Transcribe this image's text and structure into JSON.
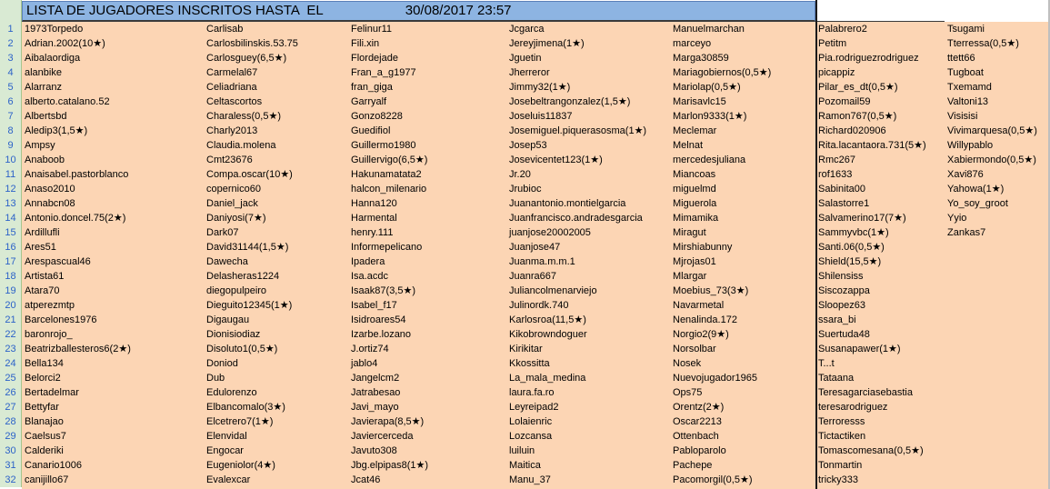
{
  "header": {
    "title": "LISTA DE JUGADORES INSCRITOS HASTA  EL",
    "datetime": "30/08/2017 23:57"
  },
  "rows": [
    {
      "n": "1",
      "c": [
        "1973Torpedo",
        "Carlisab",
        "Felinur11",
        "Jcgarca",
        "Manuelmarchan",
        "Palabrero2",
        "Tsugami"
      ]
    },
    {
      "n": "2",
      "c": [
        "Adrian.2002(10★)",
        "Carlosbilinskis.53.75",
        "Fili.xin",
        "Jereyjimena(1★)",
        "marceyo",
        "Petitm",
        "Tterressa(0,5★)"
      ]
    },
    {
      "n": "3",
      "c": [
        "Aibalaordiga",
        "Carlosguey(6,5★)",
        "Flordejade",
        "Jguetin",
        "Marga30859",
        "Pia.rodriguezrodriguez",
        "ttett66"
      ]
    },
    {
      "n": "4",
      "c": [
        "alanbike",
        "Carmelal67",
        "Fran_a_g1977",
        "Jherreror",
        "Mariagobiernos(0,5★)",
        "picappiz",
        "Tugboat"
      ]
    },
    {
      "n": "5",
      "c": [
        "Alarranz",
        "Celiadriana",
        "fran_giga",
        "Jimmy32(1★)",
        "Mariolap(0,5★)",
        "Pilar_es_dt(0,5★)",
        "Txemamd"
      ]
    },
    {
      "n": "6",
      "c": [
        "alberto.catalano.52",
        "Celtascortos",
        "Garryalf",
        "Josebeltrangonzalez(1,5★)",
        "Marisavlc15",
        "Pozomail59",
        "Valtoni13"
      ]
    },
    {
      "n": "7",
      "c": [
        "Albertsbd",
        "Charaless(0,5★)",
        "Gonzo8228",
        "Joseluis11837",
        "Marlon9333(1★)",
        "Ramon767(0,5★)",
        "Visisisi"
      ]
    },
    {
      "n": "8",
      "c": [
        "Aledip3(1,5★)",
        "Charly2013",
        "Guedifiol",
        "Josemiguel.piquerasosma(1★)",
        "Meclemar",
        "Richard020906",
        "Vivimarquesa(0,5★)"
      ]
    },
    {
      "n": "9",
      "c": [
        "Ampsy",
        "Claudia.molena",
        "Guillermo1980",
        "Josep53",
        "Melnat",
        "Rita.lacantaora.731(5★)",
        "Willypablo"
      ]
    },
    {
      "n": "10",
      "c": [
        "Anaboob",
        "Cmt23676",
        "Guillervigo(6,5★)",
        "Josevicentet123(1★)",
        "mercedesjuliana",
        "Rmc267",
        "Xabiermondo(0,5★)"
      ]
    },
    {
      "n": "11",
      "c": [
        "Anaisabel.pastorblanco",
        "Compa.oscar(10★)",
        "Hakunamatata2",
        "Jr.20",
        "Miancoas",
        "rof1633",
        "Xavi876"
      ]
    },
    {
      "n": "12",
      "c": [
        "Anaso2010",
        "copernico60",
        "halcon_milenario",
        "Jrubioc",
        "miguelmd",
        "Sabinita00",
        "Yahowa(1★)"
      ]
    },
    {
      "n": "13",
      "c": [
        "Annabcn08",
        "Daniel_jack",
        "Hanna120",
        "Juanantonio.montielgarcia",
        "Miguerola",
        "Salastorre1",
        "Yo_soy_groot"
      ]
    },
    {
      "n": "14",
      "c": [
        "Antonio.doncel.75(2★)",
        "Daniyosi(7★)",
        "Harmental",
        "Juanfrancisco.andradesgarcia",
        "Mimamika",
        "Salvamerino17(7★)",
        "Yyio"
      ]
    },
    {
      "n": "15",
      "c": [
        "Ardillufli",
        "Dark07",
        "henry.111",
        "juanjose20002005",
        "Miragut",
        "Sammyvbc(1★)",
        "Zankas7"
      ]
    },
    {
      "n": "16",
      "c": [
        "Ares51",
        "David31144(1,5★)",
        "Informepelicano",
        "Juanjose47",
        "Mirshiabunny",
        "Santi.06(0,5★)",
        ""
      ]
    },
    {
      "n": "17",
      "c": [
        "Arespascual46",
        "Dawecha",
        "Ipadera",
        "Juanma.m.m.1",
        "Mjrojas01",
        "Shield(15,5★)",
        ""
      ]
    },
    {
      "n": "18",
      "c": [
        "Artista61",
        "Delasheras1224",
        "Isa.acdc",
        "Juanra667",
        "Mlargar",
        "Shilensiss",
        ""
      ]
    },
    {
      "n": "19",
      "c": [
        "Atara70",
        "diegopulpeiro",
        "Isaak87(3,5★)",
        "Juliancolmenarviejo",
        "Moebius_73(3★)",
        "Siscozappa",
        ""
      ]
    },
    {
      "n": "20",
      "c": [
        "atperezmtp",
        "Dieguito12345(1★)",
        "Isabel_f17",
        "Julinordk.740",
        "Navarmetal",
        "Sloopez63",
        ""
      ]
    },
    {
      "n": "21",
      "c": [
        "Barcelones1976",
        "Digaugau",
        "Isidroares54",
        "Karlosroa(11,5★)",
        "Nenalinda.172",
        "ssara_bi",
        ""
      ]
    },
    {
      "n": "22",
      "c": [
        "baronrojo_",
        "Dionisiodiaz",
        "Izarbe.lozano",
        "Kikobrowndoguer",
        "Norgio2(9★)",
        "Suertuda48",
        ""
      ]
    },
    {
      "n": "23",
      "c": [
        "Beatrizballesteros6(2★)",
        "Disoluto1(0,5★)",
        "J.ortiz74",
        "Kirikitar",
        "Norsolbar",
        "Susanapawer(1★)",
        ""
      ]
    },
    {
      "n": "24",
      "c": [
        "Bella134",
        "Doniod",
        "jablo4",
        "Kkossitta",
        "Nosek",
        "T...t",
        ""
      ]
    },
    {
      "n": "25",
      "c": [
        "Belorci2",
        "Dub",
        "Jangelcm2",
        "La_mala_medina",
        "Nuevojugador1965",
        "Tataana",
        ""
      ]
    },
    {
      "n": "26",
      "c": [
        "Bertadelmar",
        "Edulorenzo",
        "Jatrabesao",
        "laura.fa.ro",
        "Ops75",
        "Teresagarciasebastia",
        ""
      ]
    },
    {
      "n": "27",
      "c": [
        "Bettyfar",
        "Elbancomalo(3★)",
        "Javi_mayo",
        "Leyreipad2",
        "Orentz(2★)",
        "teresarodriguez",
        ""
      ]
    },
    {
      "n": "28",
      "c": [
        "Blanajao",
        "Elcetrero7(1★)",
        "Javierapa(8,5★)",
        "Lolaienric",
        "Oscar2213",
        "Terroresss",
        ""
      ]
    },
    {
      "n": "29",
      "c": [
        "Caelsus7",
        "Elenvidal",
        "Javiercerceda",
        "Lozcansa",
        "Ottenbach",
        "Tictactiken",
        ""
      ]
    },
    {
      "n": "30",
      "c": [
        "Calderiki",
        "Engocar",
        "Javuto308",
        "luiluin",
        "Pabloparolo",
        "Tomascomesana(0,5★)",
        ""
      ]
    },
    {
      "n": "31",
      "c": [
        "Canario1006",
        "Eugeniolor(4★)",
        "Jbg.elpipas8(1★)",
        "Maitica",
        "Pachepe",
        "Tonmartin",
        ""
      ]
    },
    {
      "n": "32",
      "c": [
        "canijillo67",
        "Evalexcar",
        "Jcat46",
        "Manu_37",
        "Pacomorgil(0,5★)",
        "tricky333",
        ""
      ]
    }
  ]
}
